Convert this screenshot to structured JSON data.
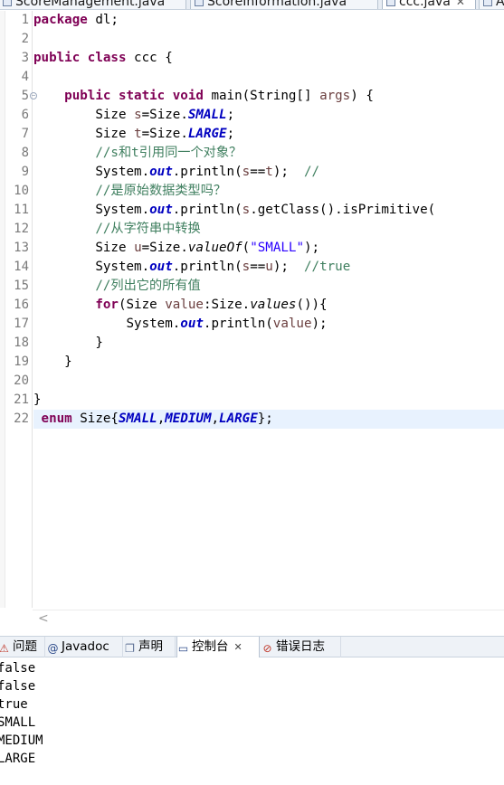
{
  "editor_tabs": [
    {
      "label": "ScoreManagement.java"
    },
    {
      "label": "ScoreInformation.java"
    },
    {
      "label": "ccc.java",
      "close": "✕"
    },
    {
      "label": "A"
    }
  ],
  "line_numbers": [
    "1",
    "2",
    "3",
    "4",
    "5",
    "6",
    "7",
    "8",
    "9",
    "10",
    "11",
    "12",
    "13",
    "14",
    "15",
    "16",
    "17",
    "18",
    "19",
    "20",
    "21",
    "22"
  ],
  "fold_marker": "−",
  "code": {
    "l1": {
      "kw": "package",
      "rest": " dl;"
    },
    "l3": {
      "kw1": "public",
      "kw2": "class",
      "rest": " ccc {"
    },
    "l5": {
      "indent": "    ",
      "kw1": "public",
      "kw2": "static",
      "kw3": "void",
      "name": " main(String[] ",
      "param": "args",
      "tail": ") {"
    },
    "l6": {
      "indent": "        ",
      "a": "Size ",
      "var": "s",
      "b": "=Size.",
      "field": "SMALL",
      "c": ";"
    },
    "l7": {
      "indent": "        ",
      "a": "Size ",
      "var": "t",
      "b": "=Size.",
      "field": "LARGE",
      "c": ";"
    },
    "l8": {
      "indent": "        ",
      "comment": "//s和t引用同一个对象？"
    },
    "l9": {
      "indent": "        ",
      "a": "System.",
      "field": "out",
      "b": ".println(",
      "var1": "s",
      "op": "==",
      "var2": "t",
      "c": ");  ",
      "comment": "//"
    },
    "l10": {
      "indent": "        ",
      "comment": "//是原始数据类型吗？"
    },
    "l11": {
      "indent": "        ",
      "a": "System.",
      "field": "out",
      "b": ".println(",
      "var": "s",
      "c": ".getClass().isPrimitive("
    },
    "l12": {
      "indent": "        ",
      "comment": "//从字符串中转换"
    },
    "l13": {
      "indent": "        ",
      "a": "Size ",
      "var": "u",
      "b": "=Size.",
      "method": "valueOf",
      "c": "(",
      "string": "\"SMALL\"",
      "d": ");"
    },
    "l14": {
      "indent": "        ",
      "a": "System.",
      "field": "out",
      "b": ".println(",
      "var1": "s",
      "op": "==",
      "var2": "u",
      "c": ");  ",
      "comment": "//true"
    },
    "l15": {
      "indent": "        ",
      "comment": "//列出它的所有值"
    },
    "l16": {
      "indent": "        ",
      "kw": "for",
      "a": "(Size ",
      "var": "value",
      "b": ":Size.",
      "method": "values",
      "c": "()){"
    },
    "l17": {
      "indent": "            ",
      "a": "System.",
      "field": "out",
      "b": ".println(",
      "var": "value",
      "c": ");"
    },
    "l18": {
      "indent": "        ",
      "text": "}"
    },
    "l19": {
      "indent": "    ",
      "text": "}"
    },
    "l21": {
      "text": "}"
    },
    "l22": {
      "indent": " ",
      "kw": "enum",
      "a": " Size{",
      "f1": "SMALL",
      "s1": ",",
      "f2": "MEDIUM",
      "s2": ",",
      "f3": "LARGE",
      "b": "};"
    }
  },
  "scroll_arrow": "<",
  "view_tabs": [
    {
      "icon": "problems-icon",
      "glyph": "⚠",
      "label": "问题",
      "color": "#c0392b"
    },
    {
      "icon": "javadoc-icon",
      "glyph": "@",
      "label": "Javadoc",
      "color": "#2c4a8a"
    },
    {
      "icon": "declaration-icon",
      "glyph": "❐",
      "label": "声明",
      "color": "#5a6e93"
    },
    {
      "icon": "console-icon",
      "glyph": "▭",
      "label": "控制台",
      "color": "#2c4a8a",
      "close": "✕"
    },
    {
      "icon": "error-log-icon",
      "glyph": "⊘",
      "label": "错误日志",
      "color": "#c0392b"
    }
  ],
  "console_lines": [
    "false",
    "false",
    "true",
    "SMALL",
    "MEDIUM",
    "LARGE"
  ]
}
